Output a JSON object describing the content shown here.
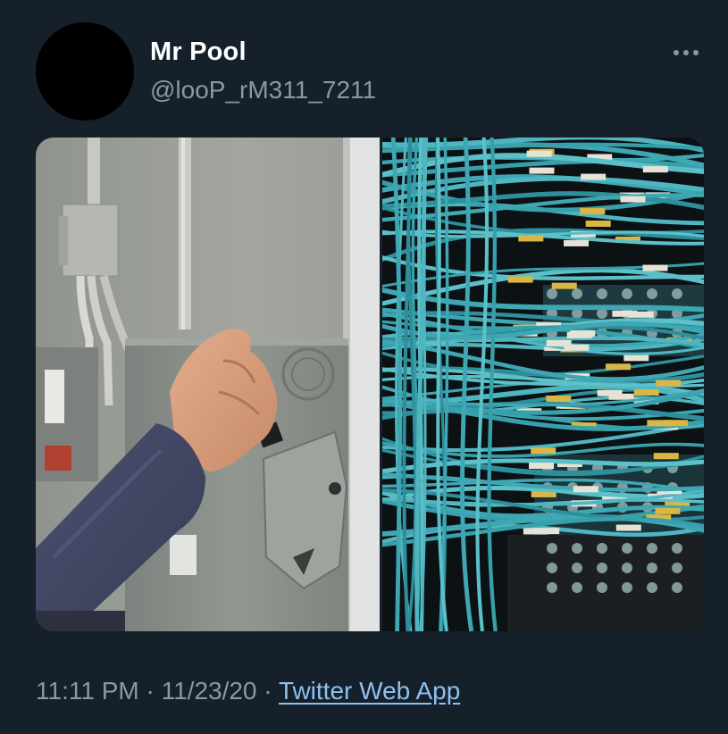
{
  "tweet": {
    "display_name": "Mr Pool",
    "handle": "@looP_rM311_7211",
    "more_icon": "more-horizontal-icon",
    "time": "11:11 PM",
    "separator": "·",
    "date": "11/23/20",
    "source": "Twitter Web App"
  },
  "colors": {
    "background": "#15202b",
    "secondary_text": "#8899a6",
    "link": "#8ec1ef"
  }
}
